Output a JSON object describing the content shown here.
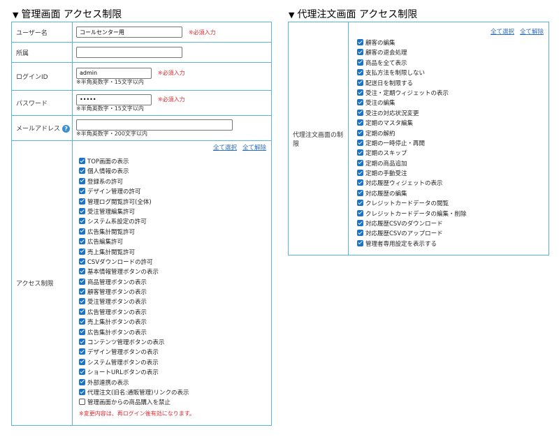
{
  "left": {
    "title": "管理画面 アクセス制限",
    "fields": {
      "username": {
        "label": "ユーザー名",
        "value": "コールセンター用",
        "required": "※必須入力"
      },
      "affiliation": {
        "label": "所属",
        "value": ""
      },
      "login_id": {
        "label": "ログインID",
        "value": "admin",
        "required": "※必須入力",
        "note": "※半角英数字・15文字以内"
      },
      "password": {
        "label": "パスワード",
        "value": "•••••",
        "required": "※必須入力",
        "note": "※半角英数字・15文字以内"
      },
      "email": {
        "label": "メールアドレス",
        "value": "",
        "help": "?",
        "note": "※半角英数字・200文字以内"
      }
    },
    "access": {
      "label": "アクセス制限",
      "select_all": "全て選択",
      "clear_all": "全て解除",
      "items": [
        {
          "label": "TOP画面の表示",
          "checked": true
        },
        {
          "label": "個人情報の表示",
          "checked": true
        },
        {
          "label": "登録系の許可",
          "checked": true
        },
        {
          "label": "デザイン管理の許可",
          "checked": true
        },
        {
          "label": "管理ログ閲覧許可(全体)",
          "checked": true
        },
        {
          "label": "受注管理編集許可",
          "checked": true
        },
        {
          "label": "システム系設定の許可",
          "checked": true
        },
        {
          "label": "広告集計閲覧許可",
          "checked": true
        },
        {
          "label": "広告編集許可",
          "checked": true
        },
        {
          "label": "売上集計閲覧許可",
          "checked": true
        },
        {
          "label": "CSVダウンロードの許可",
          "checked": true
        },
        {
          "label": "基本情報管理ボタンの表示",
          "checked": true
        },
        {
          "label": "商品管理ボタンの表示",
          "checked": true
        },
        {
          "label": "顧客管理ボタンの表示",
          "checked": true
        },
        {
          "label": "受注管理ボタンの表示",
          "checked": true
        },
        {
          "label": "広告管理ボタンの表示",
          "checked": true
        },
        {
          "label": "売上集計ボタンの表示",
          "checked": true
        },
        {
          "label": "広告集計ボタンの表示",
          "checked": true
        },
        {
          "label": "コンテンツ管理ボタンの表示",
          "checked": true
        },
        {
          "label": "デザイン管理ボタンの表示",
          "checked": true
        },
        {
          "label": "システム管理ボタンの表示",
          "checked": true
        },
        {
          "label": "ショートURLボタンの表示",
          "checked": true
        },
        {
          "label": "外部連携の表示",
          "checked": true
        },
        {
          "label": "代理注文(旧名:通販管理)リンクの表示",
          "checked": true
        },
        {
          "label": "管理画面からの商品購入を禁止",
          "checked": false
        }
      ],
      "warning": "※変更内容は、再ログイン後有効になります。"
    }
  },
  "right": {
    "title": "代理注文画面 アクセス制限",
    "label": "代理注文画面の制限",
    "select_all": "全て選択",
    "clear_all": "全て解除",
    "items": [
      {
        "label": "顧客の編集",
        "checked": true
      },
      {
        "label": "顧客の退会処理",
        "checked": true
      },
      {
        "label": "商品を全て表示",
        "checked": true
      },
      {
        "label": "支払方法を制限しない",
        "checked": true
      },
      {
        "label": "配送日を制限する",
        "checked": true
      },
      {
        "label": "受注・定期ウィジェットの表示",
        "checked": true
      },
      {
        "label": "受注の編集",
        "checked": true
      },
      {
        "label": "受注の対応状況変更",
        "checked": true
      },
      {
        "label": "定期のマスタ編集",
        "checked": true
      },
      {
        "label": "定期の解約",
        "checked": true
      },
      {
        "label": "定期の一時停止・再開",
        "checked": true
      },
      {
        "label": "定期のスキップ",
        "checked": true
      },
      {
        "label": "定期の商品追加",
        "checked": true
      },
      {
        "label": "定期の手動受注",
        "checked": true
      },
      {
        "label": "対応履歴ウィジェットの表示",
        "checked": true
      },
      {
        "label": "対応履歴の編集",
        "checked": true
      },
      {
        "label": "クレジットカードデータの閲覧",
        "checked": true
      },
      {
        "label": "クレジットカードデータの編集・削除",
        "checked": true
      },
      {
        "label": "対応履歴CSVのダウンロード",
        "checked": true
      },
      {
        "label": "対応履歴CSVのアップロード",
        "checked": true
      },
      {
        "label": "管理者専用設定を表示する",
        "checked": true
      }
    ]
  }
}
